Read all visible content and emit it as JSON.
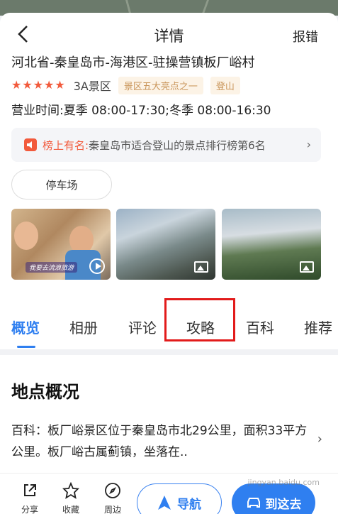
{
  "header": {
    "title": "详情",
    "report_label": "报错"
  },
  "place": {
    "address": "河北省-秦皇岛市-海港区-驻操营镇板厂峪村",
    "rating_stars": 5,
    "level": "3A景区",
    "tags": [
      "景区五大亮点之一",
      "登山"
    ],
    "hours": "营业时间:夏季 08:00-17:30;冬季 08:00-16:30"
  },
  "rank": {
    "key": "榜上有名:",
    "value": "秦皇岛市适合登山的景点排行榜第6名"
  },
  "facility": {
    "parking_label": "停车场"
  },
  "photos": {
    "video_caption": "我要去流浪旅游"
  },
  "tabs": {
    "items": [
      {
        "label": "概览"
      },
      {
        "label": "相册"
      },
      {
        "label": "评论"
      },
      {
        "label": "攻略"
      },
      {
        "label": "百科"
      },
      {
        "label": "推荐"
      }
    ],
    "active_index": 0
  },
  "overview": {
    "title": "地点概况",
    "description": "百科：板厂峪景区位于秦皇岛市北29公里，面积33平方公里。板厂峪古属蓟镇，坐落在.."
  },
  "bottom_bar": {
    "share_label": "分享",
    "favorite_label": "收藏",
    "nearby_label": "周边",
    "navigate_label": "导航",
    "route_label": "到这去"
  },
  "watermark": "jingyan.baidu.com",
  "colors": {
    "accent": "#2f7ff0",
    "star": "#f25a3c",
    "highlight": "#e21b1b",
    "tag_text": "#c9955a"
  }
}
